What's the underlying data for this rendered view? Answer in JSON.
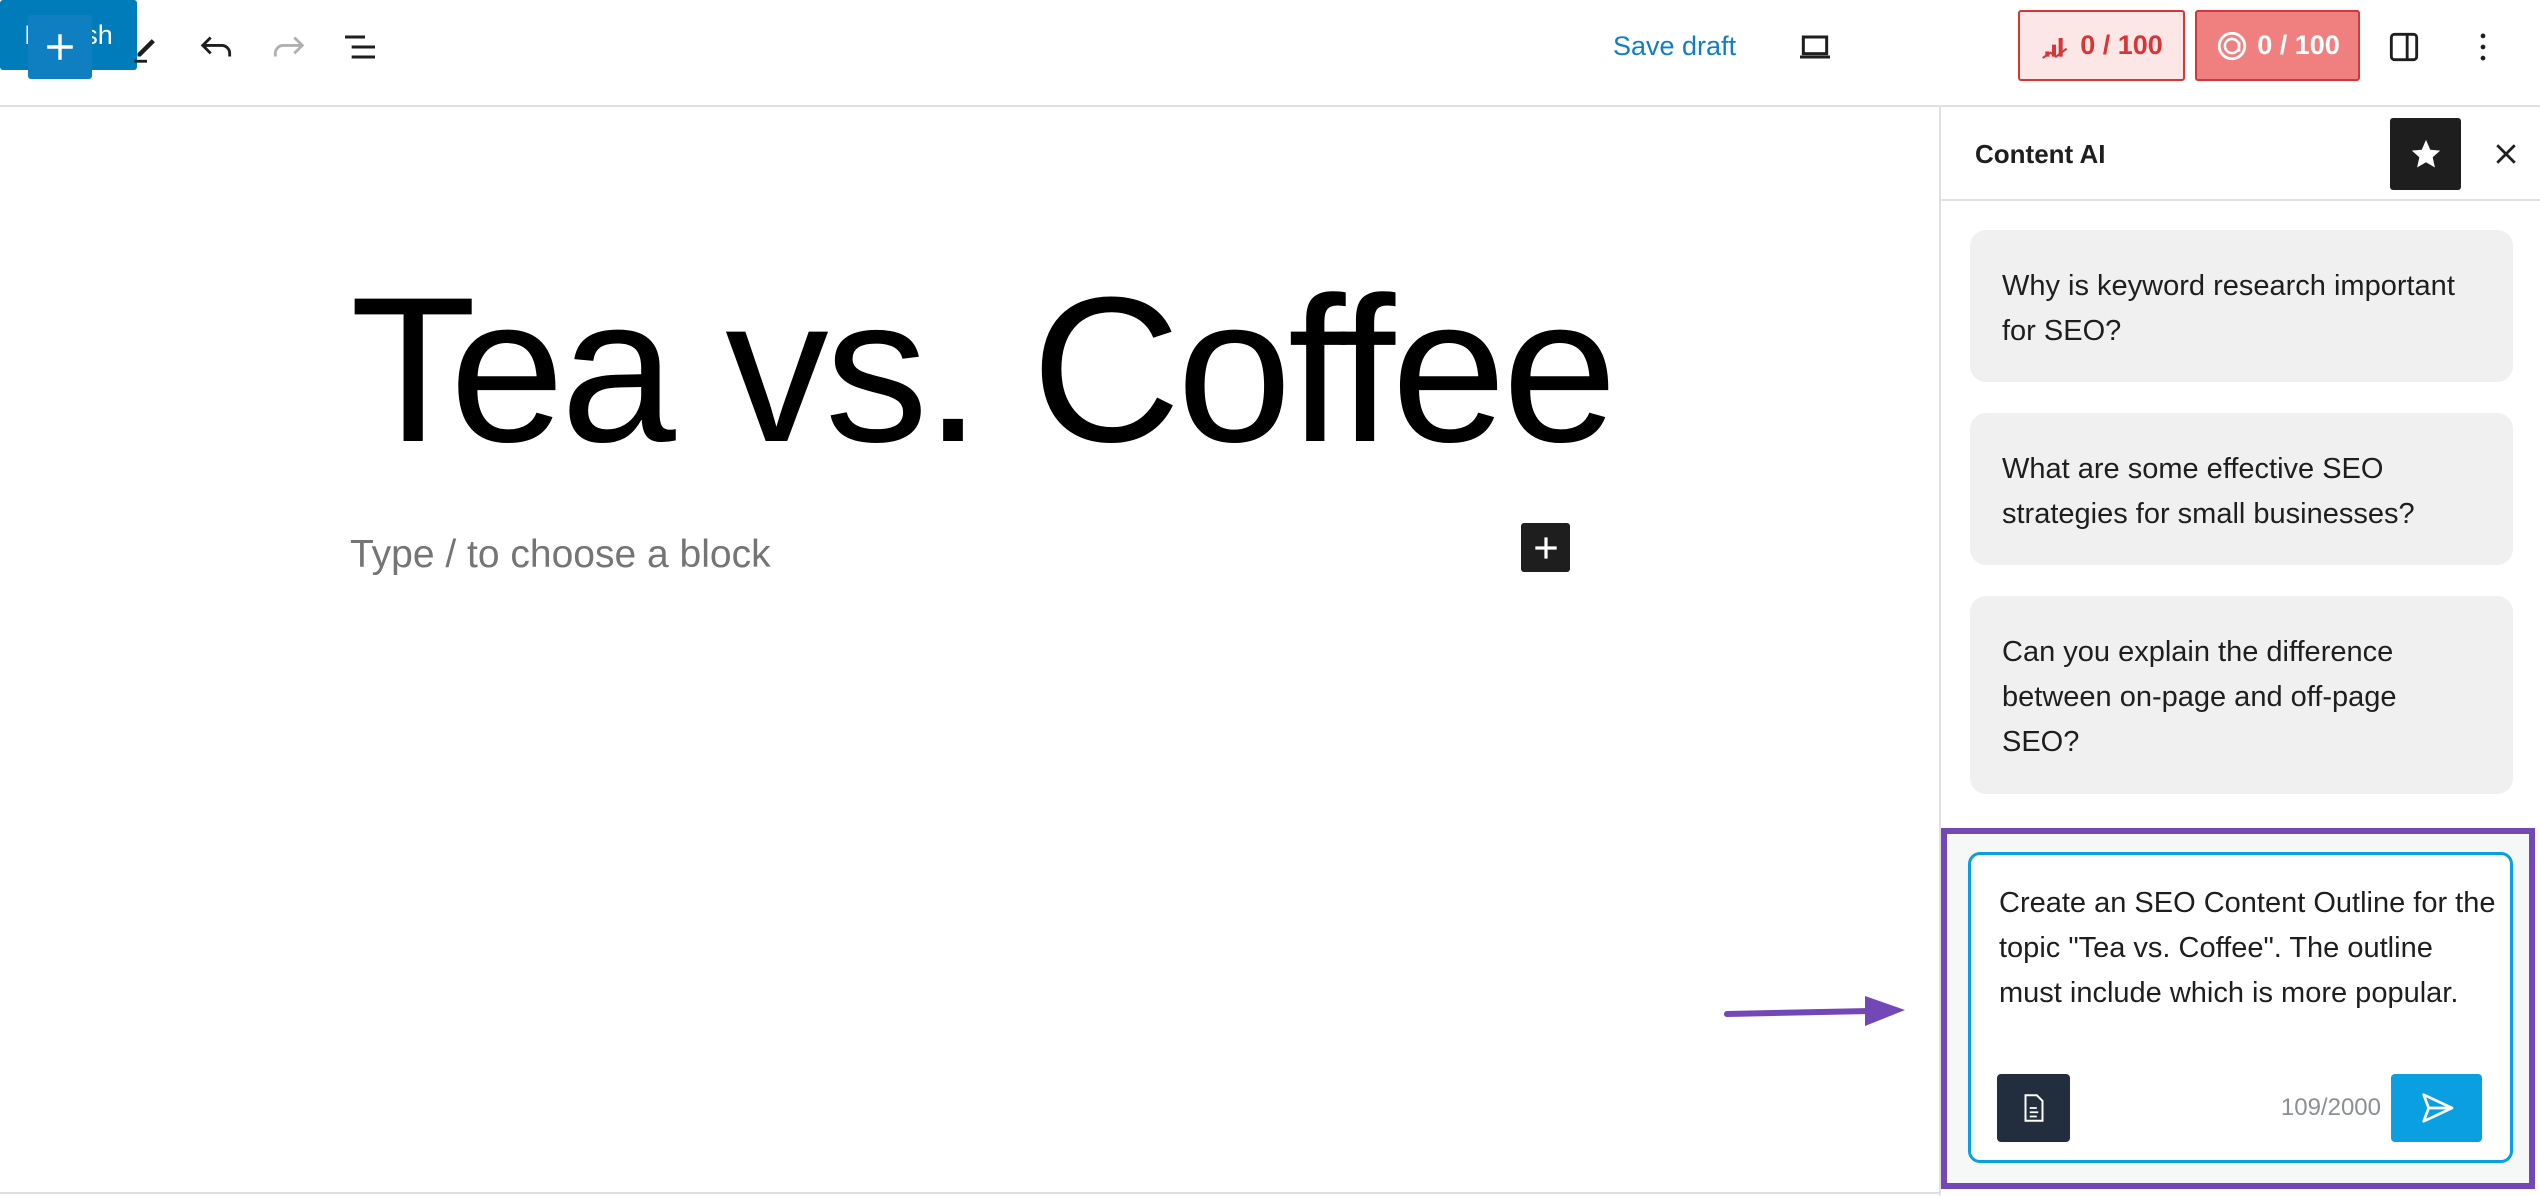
{
  "toolbar": {
    "add_block_icon": "plus-icon",
    "tools_icon": "pencil-icon",
    "undo_icon": "undo-icon",
    "redo_icon": "redo-icon",
    "list_view_icon": "list-view-icon",
    "save_draft_label": "Save draft",
    "preview_icon": "laptop-icon",
    "publish_label": "Publish",
    "seo_score": "0 / 100",
    "content_ai_score": "0 / 100",
    "settings_icon": "sidebar-toggle-icon",
    "options_icon": "kebab-icon"
  },
  "editor": {
    "title": "Tea vs. Coffee",
    "block_placeholder": "Type / to choose a block"
  },
  "sidebar": {
    "title": "Content AI",
    "suggestions": [
      "Why is keyword research important for SEO?",
      "What are some effective SEO strategies for small businesses?",
      "Can you explain the difference between on-page and off-page SEO?"
    ],
    "prompt": "Create an SEO Content Outline for the topic \"Tea vs. Coffee\". The outline must include which is more popular.",
    "char_count": "109/2000"
  },
  "colors": {
    "accent": "#007cba",
    "highlight": "#7347b5",
    "send": "#0a9fe0",
    "score_bad": "#d63638"
  }
}
